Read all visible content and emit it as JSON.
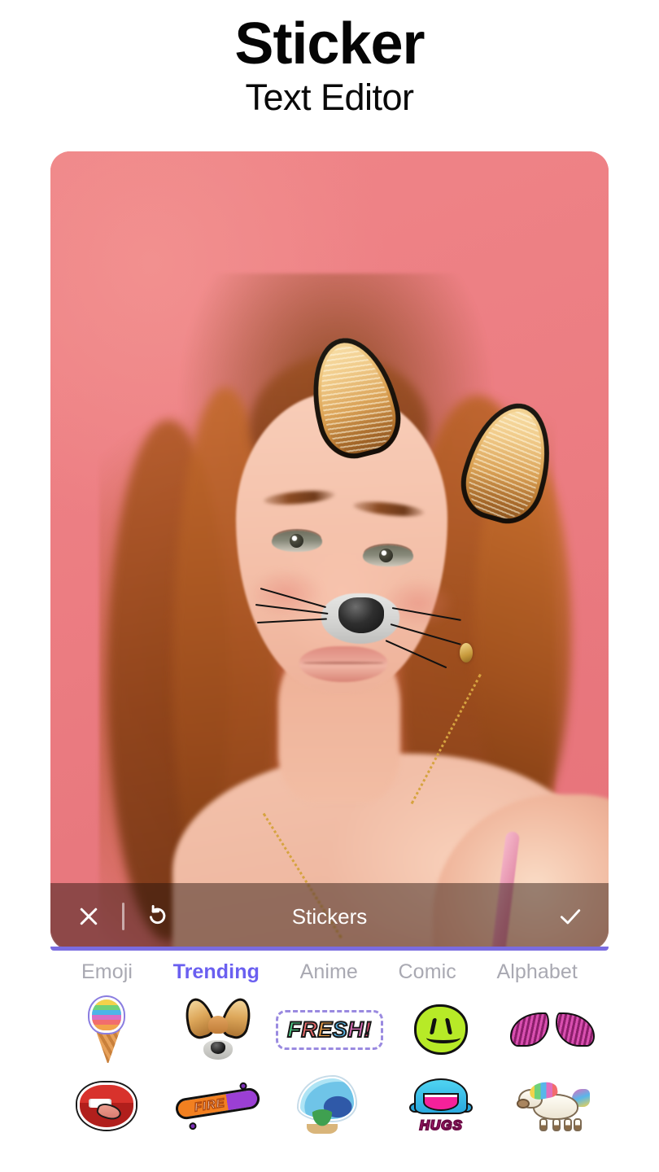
{
  "header": {
    "title": "Sticker",
    "subtitle": "Text Editor"
  },
  "editor": {
    "toolbar_title": "Stickers",
    "close_label": "✕",
    "undo_label": "↺",
    "confirm_label": "✓",
    "accent_color": "#6a5ff0",
    "underline_color": "#7a6ce0",
    "photo": {
      "background_color": "#ec7f84",
      "subject": "woman with long auburn wavy hair, gold chain necklace with crystal pendant, pink strap top",
      "applied_stickers": [
        "cat-ears",
        "cat-nose-whiskers"
      ]
    }
  },
  "categories": [
    {
      "label": "Emoji",
      "active": false
    },
    {
      "label": "Trending",
      "active": true
    },
    {
      "label": "Anime",
      "active": false
    },
    {
      "label": "Comic",
      "active": false
    },
    {
      "label": "Alphabet",
      "active": false
    }
  ],
  "stickers": [
    {
      "name": "ice-cream-cone",
      "kind": "icecream"
    },
    {
      "name": "cat-ears-nose-filter",
      "kind": "catmini"
    },
    {
      "name": "fresh-word",
      "kind": "fresh",
      "text": "FRESH!"
    },
    {
      "name": "green-wavy-smiley",
      "kind": "wavy"
    },
    {
      "name": "pink-angel-wings",
      "kind": "wings"
    },
    {
      "name": "red-lips-tongue",
      "kind": "lips"
    },
    {
      "name": "fire-skateboard",
      "kind": "board",
      "text": "FIRE"
    },
    {
      "name": "beach-wave-palm",
      "kind": "beach"
    },
    {
      "name": "shark-hugs",
      "kind": "shark",
      "text": "HUGS"
    },
    {
      "name": "rainbow-unicorn",
      "kind": "unicorn"
    }
  ]
}
